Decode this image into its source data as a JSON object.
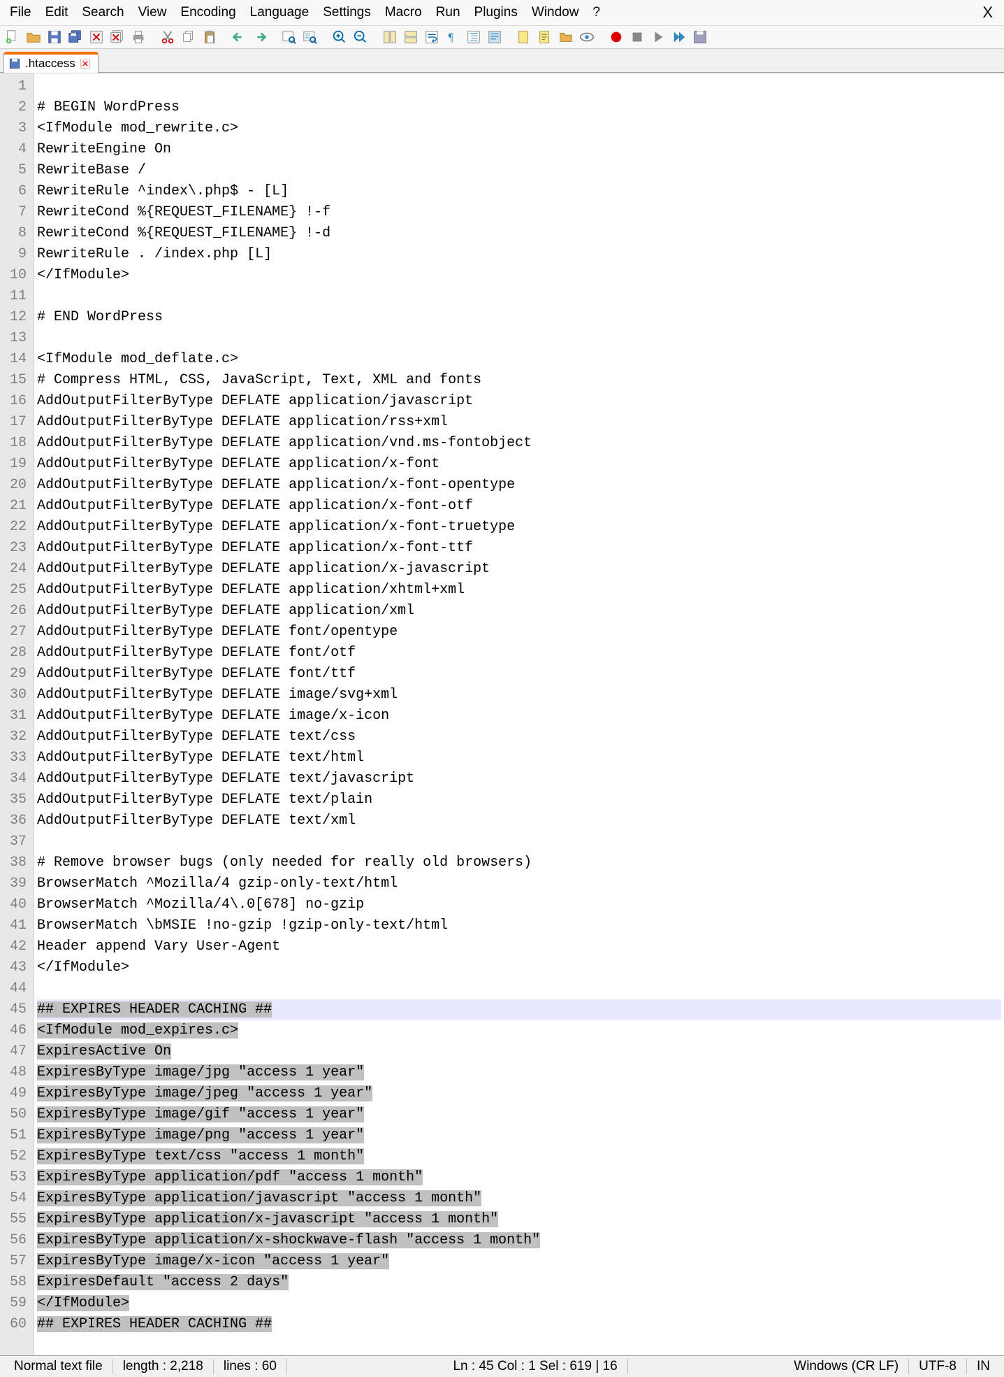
{
  "menus": [
    "File",
    "Edit",
    "Search",
    "View",
    "Encoding",
    "Language",
    "Settings",
    "Macro",
    "Run",
    "Plugins",
    "Window",
    "?"
  ],
  "window_close": "X",
  "tab": {
    "name": ".htaccess"
  },
  "code_lines": [
    "",
    "# BEGIN WordPress",
    "<IfModule mod_rewrite.c>",
    "RewriteEngine On",
    "RewriteBase /",
    "RewriteRule ^index\\.php$ - [L]",
    "RewriteCond %{REQUEST_FILENAME} !-f",
    "RewriteCond %{REQUEST_FILENAME} !-d",
    "RewriteRule . /index.php [L]",
    "</IfModule>",
    "",
    "# END WordPress",
    "",
    "<IfModule mod_deflate.c>",
    "# Compress HTML, CSS, JavaScript, Text, XML and fonts",
    "AddOutputFilterByType DEFLATE application/javascript",
    "AddOutputFilterByType DEFLATE application/rss+xml",
    "AddOutputFilterByType DEFLATE application/vnd.ms-fontobject",
    "AddOutputFilterByType DEFLATE application/x-font",
    "AddOutputFilterByType DEFLATE application/x-font-opentype",
    "AddOutputFilterByType DEFLATE application/x-font-otf",
    "AddOutputFilterByType DEFLATE application/x-font-truetype",
    "AddOutputFilterByType DEFLATE application/x-font-ttf",
    "AddOutputFilterByType DEFLATE application/x-javascript",
    "AddOutputFilterByType DEFLATE application/xhtml+xml",
    "AddOutputFilterByType DEFLATE application/xml",
    "AddOutputFilterByType DEFLATE font/opentype",
    "AddOutputFilterByType DEFLATE font/otf",
    "AddOutputFilterByType DEFLATE font/ttf",
    "AddOutputFilterByType DEFLATE image/svg+xml",
    "AddOutputFilterByType DEFLATE image/x-icon",
    "AddOutputFilterByType DEFLATE text/css",
    "AddOutputFilterByType DEFLATE text/html",
    "AddOutputFilterByType DEFLATE text/javascript",
    "AddOutputFilterByType DEFLATE text/plain",
    "AddOutputFilterByType DEFLATE text/xml",
    "",
    "# Remove browser bugs (only needed for really old browsers)",
    "BrowserMatch ^Mozilla/4 gzip-only-text/html",
    "BrowserMatch ^Mozilla/4\\.0[678] no-gzip",
    "BrowserMatch \\bMSIE !no-gzip !gzip-only-text/html",
    "Header append Vary User-Agent",
    "</IfModule>",
    "",
    "## EXPIRES HEADER CACHING ##",
    "<IfModule mod_expires.c>",
    "ExpiresActive On",
    "ExpiresByType image/jpg \"access 1 year\"",
    "ExpiresByType image/jpeg \"access 1 year\"",
    "ExpiresByType image/gif \"access 1 year\"",
    "ExpiresByType image/png \"access 1 year\"",
    "ExpiresByType text/css \"access 1 month\"",
    "ExpiresByType application/pdf \"access 1 month\"",
    "ExpiresByType application/javascript \"access 1 month\"",
    "ExpiresByType application/x-javascript \"access 1 month\"",
    "ExpiresByType application/x-shockwave-flash \"access 1 month\"",
    "ExpiresByType image/x-icon \"access 1 year\"",
    "ExpiresDefault \"access 2 days\"",
    "</IfModule>",
    "## EXPIRES HEADER CACHING ##"
  ],
  "highlight_line": 45,
  "selection_from": 45,
  "selection_to": 60,
  "status": {
    "filetype": "Normal text file",
    "length": "length : 2,218",
    "lines": "lines : 60",
    "position": "Ln : 45   Col : 1   Sel : 619 | 16",
    "eol": "Windows (CR LF)",
    "encoding": "UTF-8",
    "ins": "IN"
  }
}
